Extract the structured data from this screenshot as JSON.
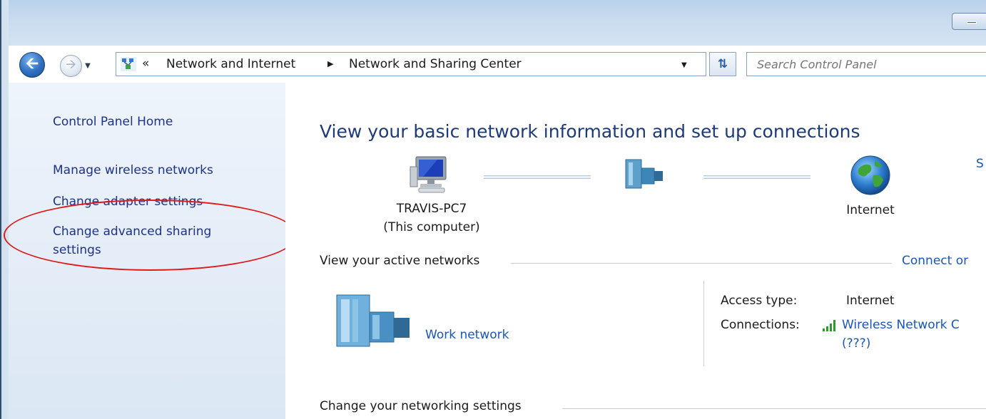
{
  "nav": {
    "back_icon": "back-arrow-icon",
    "forward_icon": "forward-arrow-icon",
    "breadcrumb": [
      "Network and Internet",
      "Network and Sharing Center"
    ],
    "search_placeholder": "Search Control Panel"
  },
  "sidebar": {
    "home": "Control Panel Home",
    "links": [
      "Manage wireless networks",
      "Change adapter settings",
      "Change advanced sharing settings"
    ]
  },
  "main": {
    "title": "View your basic network information and set up connections",
    "see_full_map": "S",
    "map": {
      "computer_name": "TRAVIS-PC7",
      "computer_sub": "(This computer)",
      "internet_label": "Internet"
    },
    "active_networks": {
      "heading": "View your active networks",
      "connect_link": "Connect or",
      "network_name": "Work network",
      "access_type_label": "Access type:",
      "access_type_value": "Internet",
      "connections_label": "Connections:",
      "connection_name": "Wireless Network C",
      "connection_sub": "(???)"
    },
    "change_settings_heading": "Change your networking settings"
  },
  "colors": {
    "link": "#1a56b8",
    "sidebar_link": "#1e3287",
    "title": "#1e3a78",
    "annotation": "#e01a1a"
  }
}
